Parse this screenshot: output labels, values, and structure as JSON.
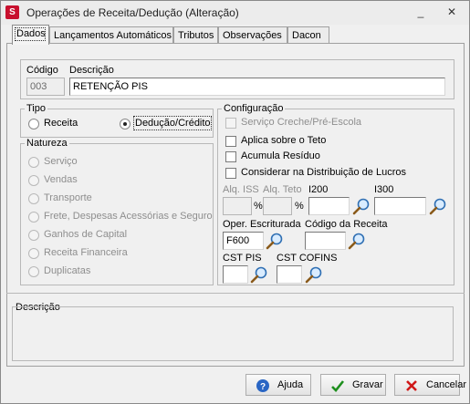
{
  "window": {
    "title": "Operações de Receita/Dedução (Alteração)",
    "min": "_",
    "close": "✕"
  },
  "tabs": [
    "Dados",
    "Lançamentos Automáticos",
    "Tributos",
    "Observações",
    "Dacon"
  ],
  "header": {
    "codigo_label": "Código",
    "codigo_value": "003",
    "descricao_label": "Descrição",
    "descricao_value": "RETENÇÃO PIS"
  },
  "tipo": {
    "label": "Tipo",
    "receita": "Receita",
    "deducao": "Dedução/Crédito",
    "selected": "deducao"
  },
  "natureza": {
    "label": "Natureza",
    "items": [
      "Serviço",
      "Vendas",
      "Transporte",
      "Frete, Despesas Acessórias e Seguro",
      "Ganhos de Capital",
      "Receita Financeira",
      "Duplicatas"
    ]
  },
  "config": {
    "label": "Configuração",
    "checks": [
      "Serviço Creche/Pré-Escola",
      "Aplica sobre o Teto",
      "Acumula Resíduo",
      "Considerar na Distribuição de Lucros"
    ],
    "aliq_iss": "Alq. ISS",
    "aliq_teto": "Alq. Teto",
    "pct": "%",
    "i200": "I200",
    "i300": "I300",
    "oper_label": "Oper. Escriturada",
    "oper_value": "F600",
    "cod_receita": "Código da Receita",
    "cst_pis": "CST PIS",
    "cst_cofins": "CST COFINS"
  },
  "descricao_label": "Descrição",
  "buttons": {
    "ajuda": "Ajuda",
    "gravar": "Gravar",
    "cancelar": "Cancelar"
  }
}
